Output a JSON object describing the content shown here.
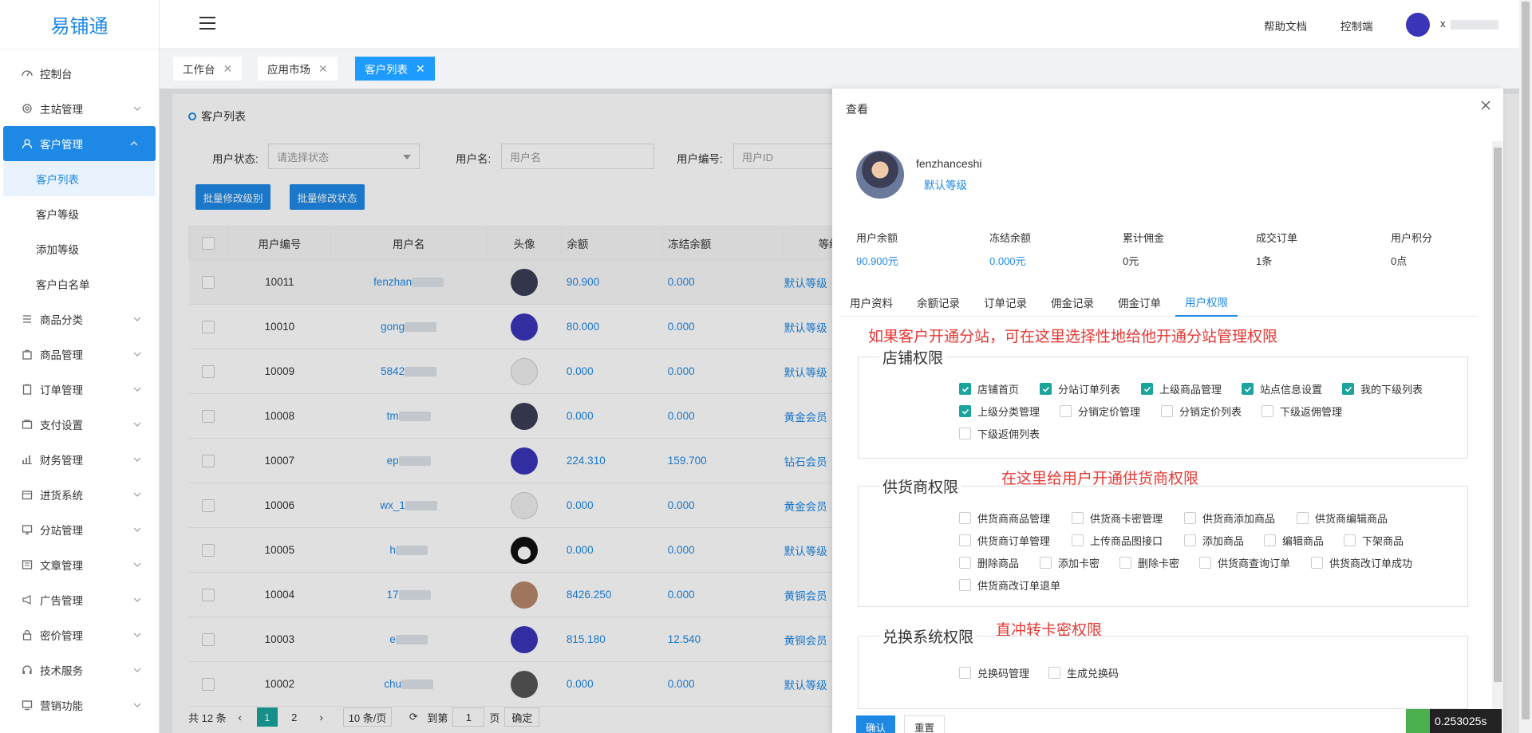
{
  "app": {
    "logo": "易铺通"
  },
  "header": {
    "help": "帮助文档",
    "console": "控制端",
    "username": "x"
  },
  "sidebar": {
    "items": [
      {
        "label": "控制台",
        "icon": "dashboard-icon"
      },
      {
        "label": "主站管理",
        "icon": "gear-icon"
      },
      {
        "label": "客户管理",
        "icon": "user-icon"
      },
      {
        "label": "商品分类",
        "icon": "list-icon"
      },
      {
        "label": "商品管理",
        "icon": "bag-icon"
      },
      {
        "label": "订单管理",
        "icon": "clipboard-icon"
      },
      {
        "label": "支付设置",
        "icon": "wallet-icon"
      },
      {
        "label": "财务管理",
        "icon": "chart-icon"
      },
      {
        "label": "进货系统",
        "icon": "box-icon"
      },
      {
        "label": "分站管理",
        "icon": "monitor-icon"
      },
      {
        "label": "文章管理",
        "icon": "article-icon"
      },
      {
        "label": "广告管理",
        "icon": "megaphone-icon"
      },
      {
        "label": "密价管理",
        "icon": "lock-icon"
      },
      {
        "label": "技术服务",
        "icon": "headset-icon"
      },
      {
        "label": "营销功能",
        "icon": "screen-icon"
      }
    ],
    "sub": [
      "客户列表",
      "客户等级",
      "添加等级",
      "客户白名单"
    ]
  },
  "tabs": [
    {
      "label": "工作台"
    },
    {
      "label": "应用市场"
    },
    {
      "label": "客户列表"
    }
  ],
  "list": {
    "title": "客户列表",
    "filters": {
      "status_label": "用户状态:",
      "status_placeholder": "请选择状态",
      "name_label": "用户名:",
      "name_placeholder": "用户名",
      "id_label": "用户编号:",
      "id_placeholder": "用户ID"
    },
    "btn_level": "批量修改级别",
    "btn_status": "批量修改状态",
    "columns": [
      "用户编号",
      "用户名",
      "头像",
      "余额",
      "冻结余额",
      "等级"
    ],
    "rows": [
      {
        "id": "10011",
        "name": "fenzhan",
        "balance": "90.900",
        "frozen": "0.000",
        "level": "默认等级"
      },
      {
        "id": "10010",
        "name": "gong",
        "balance": "80.000",
        "frozen": "0.000",
        "level": "默认等级"
      },
      {
        "id": "10009",
        "name": "5842",
        "balance": "0.000",
        "frozen": "0.000",
        "level": "默认等级"
      },
      {
        "id": "10008",
        "name": "tm",
        "balance": "0.000",
        "frozen": "0.000",
        "level": "黄金会员"
      },
      {
        "id": "10007",
        "name": "ep",
        "balance": "224.310",
        "frozen": "159.700",
        "level": "钻石会员"
      },
      {
        "id": "10006",
        "name": "wx_1",
        "balance": "0.000",
        "frozen": "0.000",
        "level": "黄金会员"
      },
      {
        "id": "10005",
        "name": "h",
        "balance": "0.000",
        "frozen": "0.000",
        "level": "默认等级"
      },
      {
        "id": "10004",
        "name": "17",
        "balance": "8426.250",
        "frozen": "0.000",
        "level": "黄铜会员"
      },
      {
        "id": "10003",
        "name": "e",
        "balance": "815.180",
        "frozen": "12.540",
        "level": "黄铜会员"
      },
      {
        "id": "10002",
        "name": "chu",
        "balance": "0.000",
        "frozen": "0.000",
        "level": "默认等级"
      }
    ],
    "pager": {
      "total": "共 12 条",
      "p1": "1",
      "p2": "2",
      "size": "10 条/页",
      "goto": "到第",
      "page_input": "1",
      "page_unit": "页",
      "confirm": "确定"
    }
  },
  "drawer": {
    "title": "查看",
    "profile": {
      "name": "fenzhanceshi",
      "level": "默认等级"
    },
    "stats": [
      {
        "label": "用户余额",
        "value": "90.900元"
      },
      {
        "label": "冻结余额",
        "value": "0.000元"
      },
      {
        "label": "累计佣金",
        "value": "0元"
      },
      {
        "label": "成交订单",
        "value": "1条"
      },
      {
        "label": "用户积分",
        "value": "0点"
      }
    ],
    "tabs": [
      "用户资料",
      "余额记录",
      "订单记录",
      "佣金记录",
      "佣金订单",
      "用户权限"
    ],
    "notes": {
      "shop": "如果客户开通分站，可在这里选择性地给他开通分站管理权限",
      "supplier": "在这里给用户开通供货商权限",
      "exchange": "直冲转卡密权限"
    },
    "groups": {
      "shop": {
        "title": "店铺权限",
        "items": [
          "店铺首页",
          "分站订单列表",
          "上级商品管理",
          "站点信息设置",
          "我的下级列表",
          "上级分类管理",
          "分销定价管理",
          "分销定价列表",
          "下级返佣管理",
          "下级返佣列表"
        ]
      },
      "supplier": {
        "title": "供货商权限",
        "items": [
          "供货商商品管理",
          "供货商卡密管理",
          "供货商添加商品",
          "供货商编辑商品",
          "供货商订单管理",
          "上传商品图接口",
          "添加商品",
          "编辑商品",
          "下架商品",
          "删除商品",
          "添加卡密",
          "删除卡密",
          "供货商查询订单",
          "供货商改订单成功",
          "供货商改订单退单"
        ]
      },
      "exchange": {
        "title": "兑换系统权限",
        "items": [
          "兑换码管理",
          "生成兑换码"
        ]
      }
    },
    "confirm": "确认",
    "reset": "重置"
  },
  "timer": "0.253025s",
  "colors": {
    "primary": "#1e88e5",
    "check": "#1ba39c",
    "note": "#e53935"
  }
}
